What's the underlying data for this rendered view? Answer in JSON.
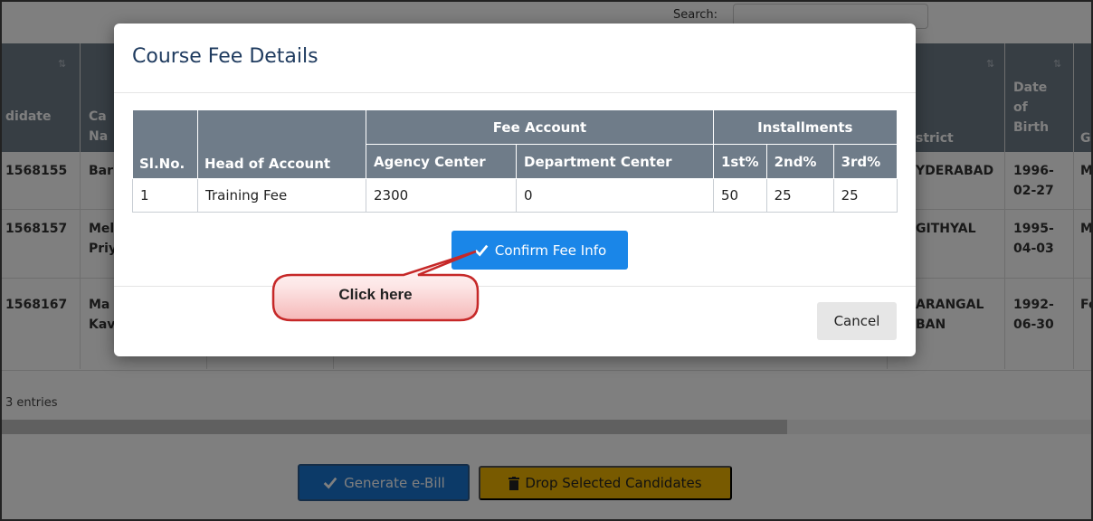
{
  "background": {
    "search_label": "Search:",
    "table_headers": [
      "didate",
      "Ca\nNa",
      "strict",
      "Date\nof\nBirth",
      "G"
    ],
    "rows": [
      {
        "id": "1568155",
        "name": "Bar",
        "district": "YDERABAD",
        "dob": "1996-\n02-27",
        "g": "M"
      },
      {
        "id": "1568157",
        "name": "Mel\nPriy",
        "district": "GITHYAL",
        "dob": "1995-\n04-03",
        "g": "M"
      },
      {
        "id": "1568167",
        "name": "Ma\nKav",
        "district": "ARANGAL\nBAN",
        "dob": "1992-\n06-30",
        "g": "Fe"
      }
    ],
    "entries_text": "3 entries",
    "generate_bill_label": "Generate e-Bill",
    "drop_label": "Drop Selected Candidates",
    "colors": {
      "generate_bill": "#1874d1",
      "drop": "#f0b400",
      "table_header": "#6f7c89"
    }
  },
  "modal": {
    "title": "Course Fee Details",
    "table": {
      "group_headers": {
        "fee_account": "Fee Account",
        "installments": "Installments"
      },
      "columns": [
        "Sl.No.",
        "Head of Account",
        "Agency Center",
        "Department Center",
        "1st%",
        "2nd%",
        "3rd%"
      ],
      "rows": [
        [
          "1",
          "Training Fee",
          "2300",
          "0",
          "50",
          "25",
          "25"
        ]
      ]
    },
    "confirm_label": "Confirm Fee Info",
    "cancel_label": "Cancel",
    "colors": {
      "confirm": "#1a86e8",
      "title": "#1f3b5f"
    }
  },
  "callout": {
    "text": "Click here",
    "colors": {
      "border": "#c62828"
    }
  }
}
